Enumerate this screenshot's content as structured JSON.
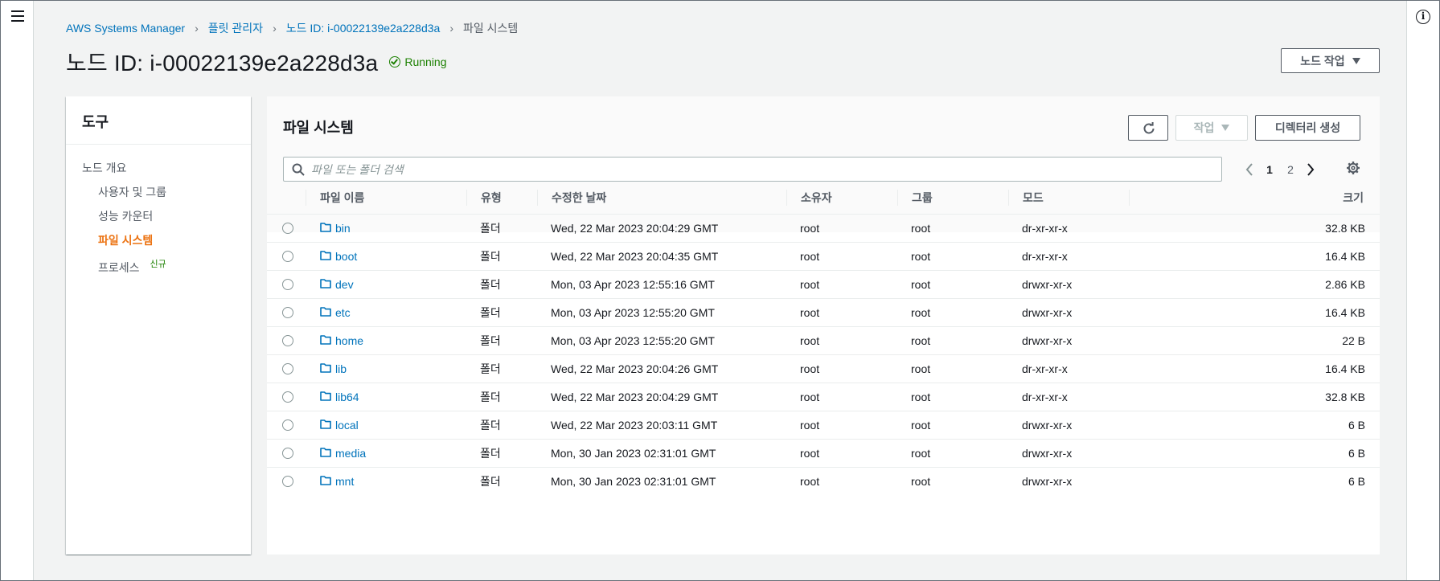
{
  "breadcrumb": {
    "items": [
      "AWS Systems Manager",
      "플릿 관리자",
      "노드 ID: i-00022139e2a228d3a"
    ],
    "current": "파일 시스템"
  },
  "page": {
    "title": "노드 ID: i-00022139e2a228d3a",
    "status": "Running",
    "node_action_label": "노드 작업"
  },
  "tools": {
    "title": "도구",
    "items": [
      {
        "label": "노드 개요",
        "level": 0
      },
      {
        "label": "사용자 및 그룹",
        "level": 1
      },
      {
        "label": "성능 카운터",
        "level": 1
      },
      {
        "label": "파일 시스템",
        "level": 1,
        "active": true
      },
      {
        "label": "프로세스",
        "level": 1,
        "badge": "신규"
      }
    ]
  },
  "filesystem": {
    "title": "파일 시스템",
    "action_label": "작업",
    "mkdir_label": "디렉터리 생성",
    "search_placeholder": "파일 또는 폴더 검색",
    "pages": [
      "1",
      "2"
    ],
    "current_page": "1",
    "columns": [
      "파일 이름",
      "유형",
      "수정한 날짜",
      "소유자",
      "그룹",
      "모드",
      "크기"
    ],
    "rows": [
      {
        "name": "bin",
        "type": "폴더",
        "modified": "Wed, 22 Mar 2023 20:04:29 GMT",
        "owner": "root",
        "group": "root",
        "mode": "dr-xr-xr-x",
        "size": "32.8 KB"
      },
      {
        "name": "boot",
        "type": "폴더",
        "modified": "Wed, 22 Mar 2023 20:04:35 GMT",
        "owner": "root",
        "group": "root",
        "mode": "dr-xr-xr-x",
        "size": "16.4 KB"
      },
      {
        "name": "dev",
        "type": "폴더",
        "modified": "Mon, 03 Apr 2023 12:55:16 GMT",
        "owner": "root",
        "group": "root",
        "mode": "drwxr-xr-x",
        "size": "2.86 KB"
      },
      {
        "name": "etc",
        "type": "폴더",
        "modified": "Mon, 03 Apr 2023 12:55:20 GMT",
        "owner": "root",
        "group": "root",
        "mode": "drwxr-xr-x",
        "size": "16.4 KB"
      },
      {
        "name": "home",
        "type": "폴더",
        "modified": "Mon, 03 Apr 2023 12:55:20 GMT",
        "owner": "root",
        "group": "root",
        "mode": "drwxr-xr-x",
        "size": "22 B"
      },
      {
        "name": "lib",
        "type": "폴더",
        "modified": "Wed, 22 Mar 2023 20:04:26 GMT",
        "owner": "root",
        "group": "root",
        "mode": "dr-xr-xr-x",
        "size": "16.4 KB"
      },
      {
        "name": "lib64",
        "type": "폴더",
        "modified": "Wed, 22 Mar 2023 20:04:29 GMT",
        "owner": "root",
        "group": "root",
        "mode": "dr-xr-xr-x",
        "size": "32.8 KB"
      },
      {
        "name": "local",
        "type": "폴더",
        "modified": "Wed, 22 Mar 2023 20:03:11 GMT",
        "owner": "root",
        "group": "root",
        "mode": "drwxr-xr-x",
        "size": "6 B"
      },
      {
        "name": "media",
        "type": "폴더",
        "modified": "Mon, 30 Jan 2023 02:31:01 GMT",
        "owner": "root",
        "group": "root",
        "mode": "drwxr-xr-x",
        "size": "6 B"
      },
      {
        "name": "mnt",
        "type": "폴더",
        "modified": "Mon, 30 Jan 2023 02:31:01 GMT",
        "owner": "root",
        "group": "root",
        "mode": "drwxr-xr-x",
        "size": "6 B"
      }
    ]
  },
  "colors": {
    "link": "#0073bb",
    "active": "#ec7211",
    "success": "#1d8102",
    "text": "#16191f",
    "muted": "#545b64"
  },
  "icons": [
    "menu-icon",
    "info-icon",
    "status-check-icon",
    "refresh-icon",
    "search-icon",
    "chevron-left-icon",
    "chevron-right-icon",
    "settings-icon",
    "folder-icon"
  ]
}
